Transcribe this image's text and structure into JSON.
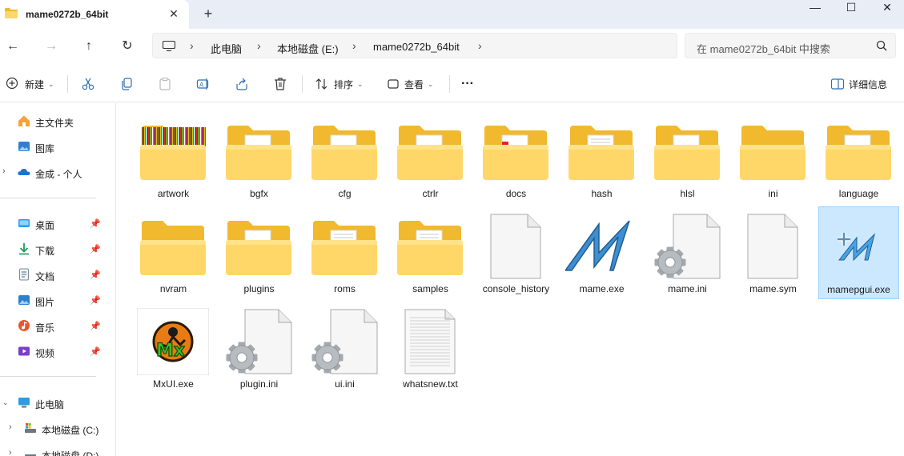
{
  "window": {
    "tab_title": "mame0272b_64bit",
    "close_tab": "✕",
    "new_tab": "+",
    "minimize": "—",
    "maximize": "☐",
    "close": "✕"
  },
  "nav": {
    "back": "←",
    "forward": "→",
    "up": "↑",
    "refresh": "↻"
  },
  "address": {
    "crumbs": [
      "此电脑",
      "本地磁盘 (E:)",
      "mame0272b_64bit"
    ],
    "separator": "›"
  },
  "search": {
    "placeholder": "在 mame0272b_64bit 中搜索"
  },
  "commands": {
    "new_label": "新建",
    "sort_label": "排序",
    "view_label": "查看",
    "more_label": "···",
    "details_label": "详细信息"
  },
  "sidebar": {
    "items": [
      {
        "label": "主文件夹",
        "icon": "home-icon"
      },
      {
        "label": "图库",
        "icon": "gallery-icon"
      },
      {
        "label": "金成 - 个人",
        "icon": "onedrive-icon"
      },
      {
        "label": "桌面",
        "icon": "desktop-icon"
      },
      {
        "label": "下载",
        "icon": "download-icon"
      },
      {
        "label": "文档",
        "icon": "document-icon"
      },
      {
        "label": "图片",
        "icon": "pictures-icon"
      },
      {
        "label": "音乐",
        "icon": "music-icon"
      },
      {
        "label": "视频",
        "icon": "video-icon"
      },
      {
        "label": "此电脑",
        "icon": "pc-icon"
      },
      {
        "label": "本地磁盘 (C:)",
        "icon": "drive-icon"
      },
      {
        "label": "本地磁盘 (D:)",
        "icon": "drive-icon"
      }
    ]
  },
  "files": [
    {
      "name": "artwork",
      "kind": "folder-colorbars"
    },
    {
      "name": "bgfx",
      "kind": "folder-doc"
    },
    {
      "name": "cfg",
      "kind": "folder-doc"
    },
    {
      "name": "ctrlr",
      "kind": "folder-doc"
    },
    {
      "name": "docs",
      "kind": "folder-pdf"
    },
    {
      "name": "hash",
      "kind": "folder-lines"
    },
    {
      "name": "hlsl",
      "kind": "folder-doc"
    },
    {
      "name": "ini",
      "kind": "folder-empty"
    },
    {
      "name": "language",
      "kind": "folder-doc"
    },
    {
      "name": "nvram",
      "kind": "folder-empty"
    },
    {
      "name": "plugins",
      "kind": "folder-doc"
    },
    {
      "name": "roms",
      "kind": "folder-lines"
    },
    {
      "name": "samples",
      "kind": "folder-lines"
    },
    {
      "name": "console_history",
      "kind": "file-blank"
    },
    {
      "name": "mame.exe",
      "kind": "mame-logo"
    },
    {
      "name": "mame.ini",
      "kind": "ini-gear"
    },
    {
      "name": "mame.sym",
      "kind": "file-blank"
    },
    {
      "name": "mamepgui.exe",
      "kind": "mamepgui-logo"
    },
    {
      "name": "MxUI.exe",
      "kind": "mxui-logo"
    },
    {
      "name": "plugin.ini",
      "kind": "ini-gear"
    },
    {
      "name": "ui.ini",
      "kind": "ini-gear"
    },
    {
      "name": "whatsnew.txt",
      "kind": "text-file"
    }
  ],
  "colors": {
    "selection_bg": "#cce8ff",
    "selection_border": "#99d1ff",
    "folder_back": "#f0b92e",
    "folder_front": "#ffd768",
    "mame_blue": "#3d8fd1"
  }
}
